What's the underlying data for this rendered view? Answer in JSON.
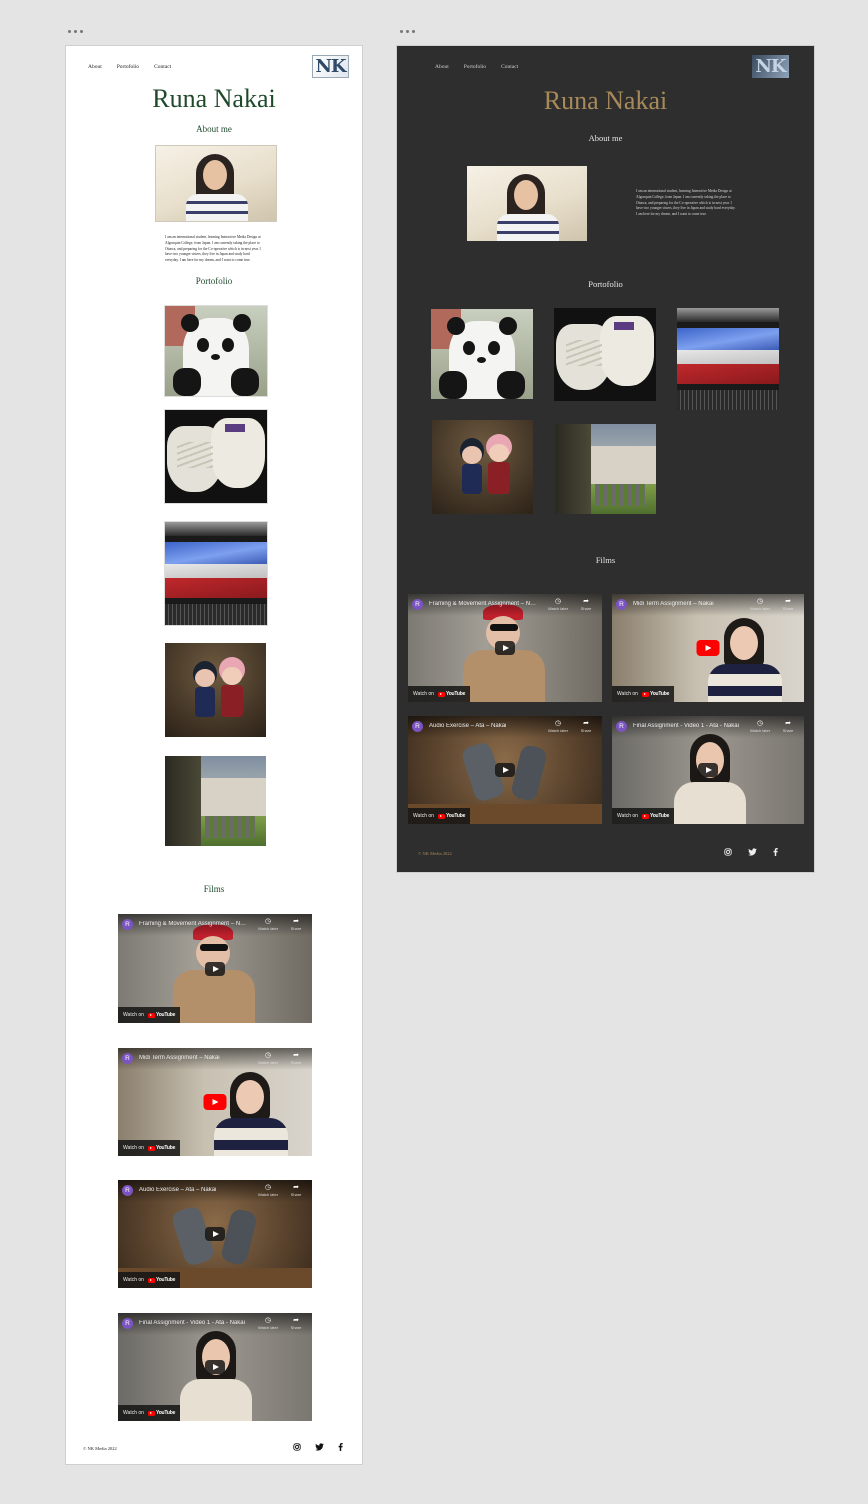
{
  "site": {
    "nav": [
      "About",
      "Portofolio",
      "Contact"
    ],
    "logo_text": "NK",
    "title": "Runa Nakai",
    "about_heading": "About me",
    "about_text": "I am an international student, learning Interactive Media Design at Algonquin College, from Japan. I am currently taking the place to Ottawa, and preparing for the Co-operative which is in next year. I have two younger sisters, they live in Japan and study hard everyday. I am here for my dream, and I want to come true.",
    "portfolio_heading": "Portofolio",
    "films_heading": "Films",
    "videos": [
      {
        "avatar": "R",
        "title": "Framing & Movement Assignment – Na...",
        "watch_later": "Watch later",
        "share": "Share",
        "watch_on": "Watch on",
        "youtube": "YouTube"
      },
      {
        "avatar": "R",
        "title": "Midi Term Assignment – Nakai",
        "watch_later": "Watch later",
        "share": "Share",
        "watch_on": "Watch on",
        "youtube": "YouTube"
      },
      {
        "avatar": "R",
        "title": "Audio Exercise – Ata – Nakai",
        "watch_later": "Watch later",
        "share": "Share",
        "watch_on": "Watch on",
        "youtube": "YouTube"
      },
      {
        "avatar": "R",
        "title": "Final Assignment - Video 1 - Ata - Nakai",
        "watch_later": "Watch later",
        "share": "Share",
        "watch_on": "Watch on",
        "youtube": "YouTube"
      }
    ],
    "footer": "© NK Media 2022",
    "social_icons": [
      "instagram-icon",
      "twitter-icon",
      "facebook-icon"
    ]
  },
  "colors": {
    "light_title": "#1f4a2c",
    "dark_title": "#a88a5a",
    "dark_bg": "#2e2e2e",
    "canvas_bg": "#e4e4e4",
    "youtube_red": "#ff0000"
  }
}
